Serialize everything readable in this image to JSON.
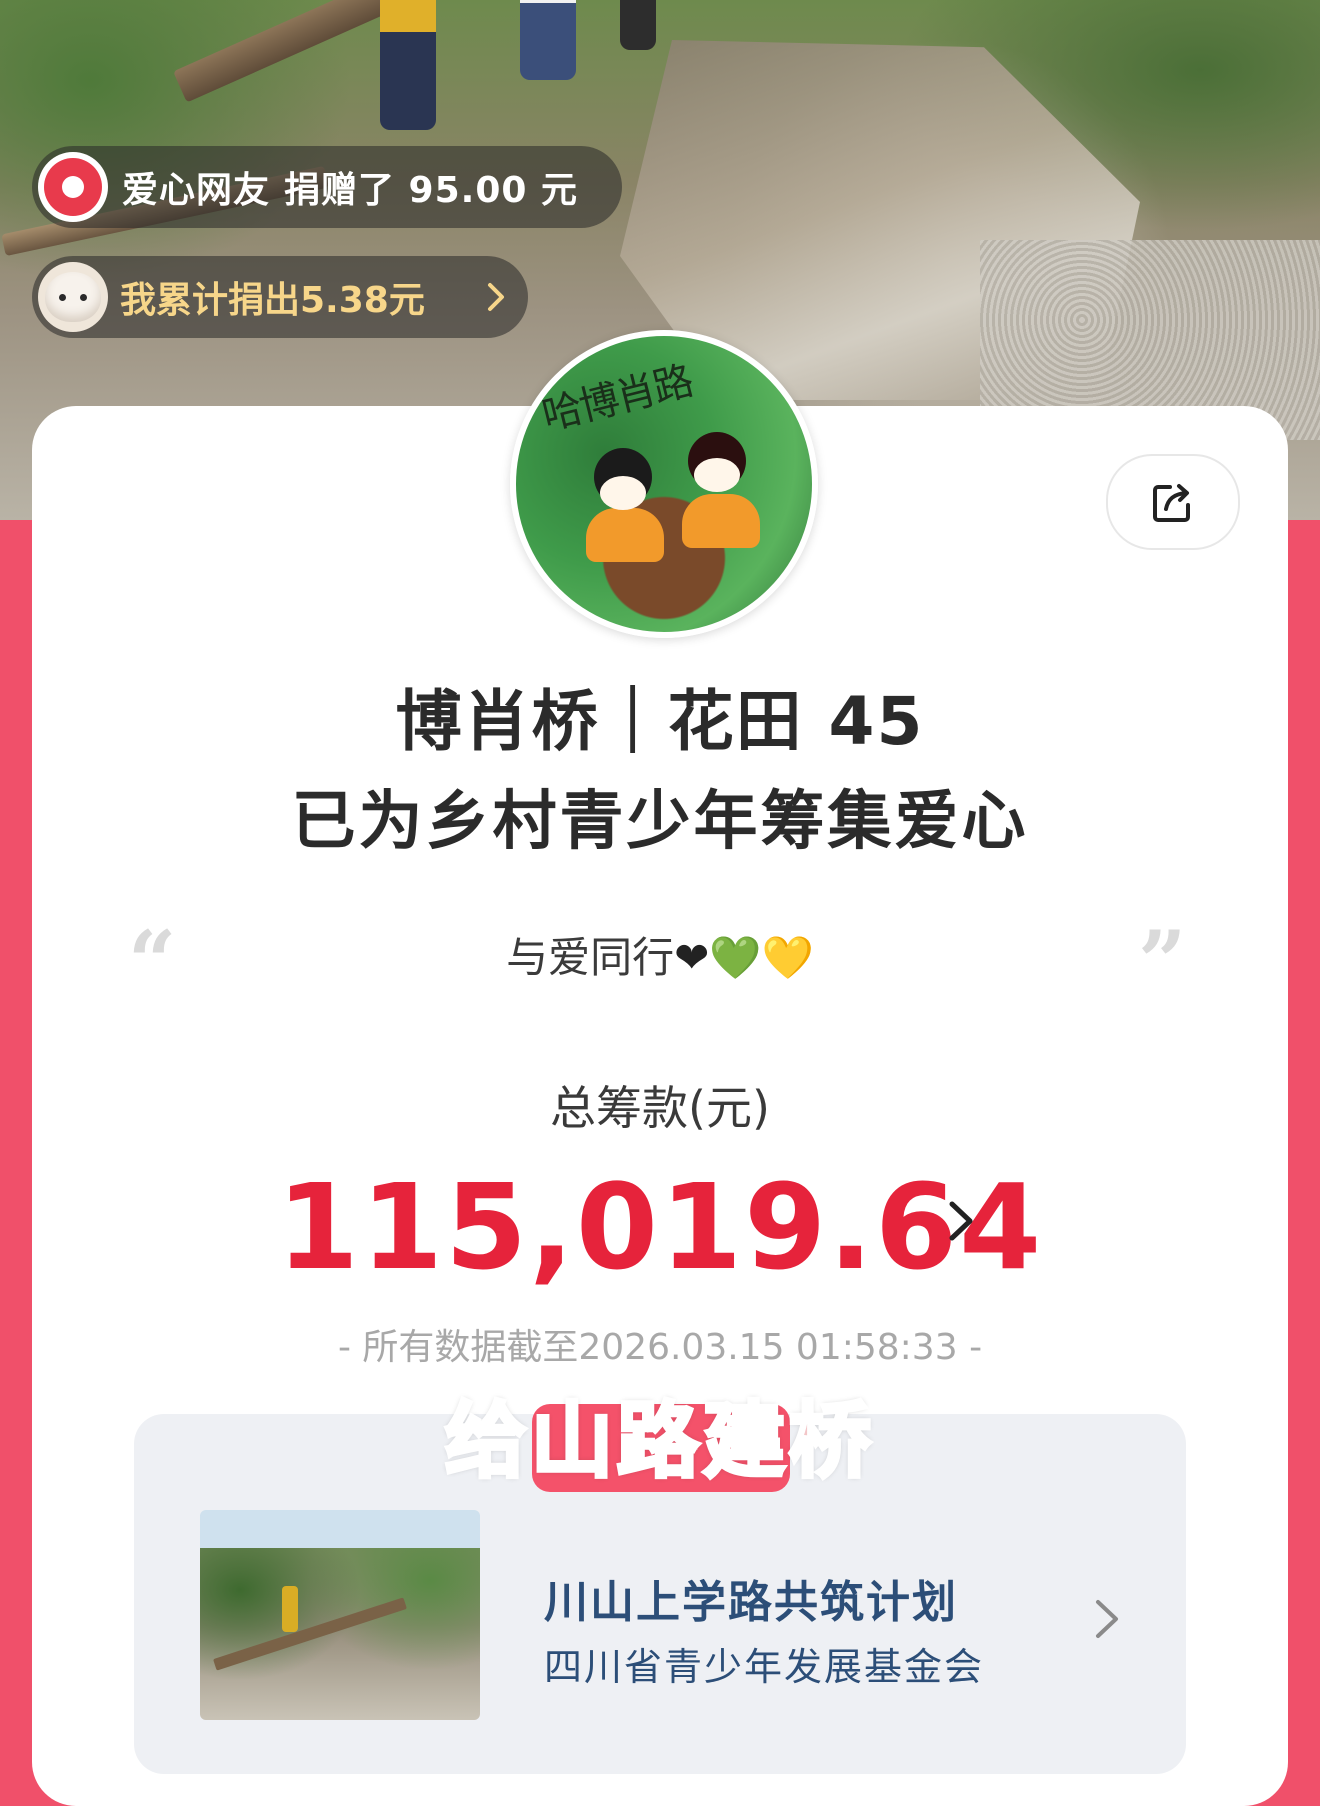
{
  "live_toasts": {
    "donation": {
      "donor": "爱心网友",
      "text": "捐赠了 95.00 元"
    },
    "my_total": {
      "text": "我累计捐出5.38元",
      "chevron": "chevron-right-icon"
    }
  },
  "profile": {
    "avatar_text": "哈博肖路",
    "title_line1": "博肖桥｜花田 45",
    "title_line2": "已为乡村青少年筹集爱心",
    "motto": "与爱同行",
    "motto_hearts": [
      "❤",
      "💚",
      "💛"
    ],
    "quote_open": "“",
    "quote_close": "”"
  },
  "fundraising": {
    "total_label": "总筹款(元)",
    "total_amount": "115,019.64",
    "as_of": "- 所有数据截至2026.03.15 01:58:33 -"
  },
  "video_caption": "给山路建桥",
  "project": {
    "name": "川山上学路共筑计划",
    "organization": "四川省青少年发展基金会"
  },
  "colors": {
    "accent_red": "#e6233b",
    "page_pink": "#f0506a",
    "project_text": "#2c4e78"
  },
  "icons": {
    "share": "share-icon",
    "amount_chevron": "chevron-right-icon",
    "project_chevron": "chevron-right-icon"
  }
}
